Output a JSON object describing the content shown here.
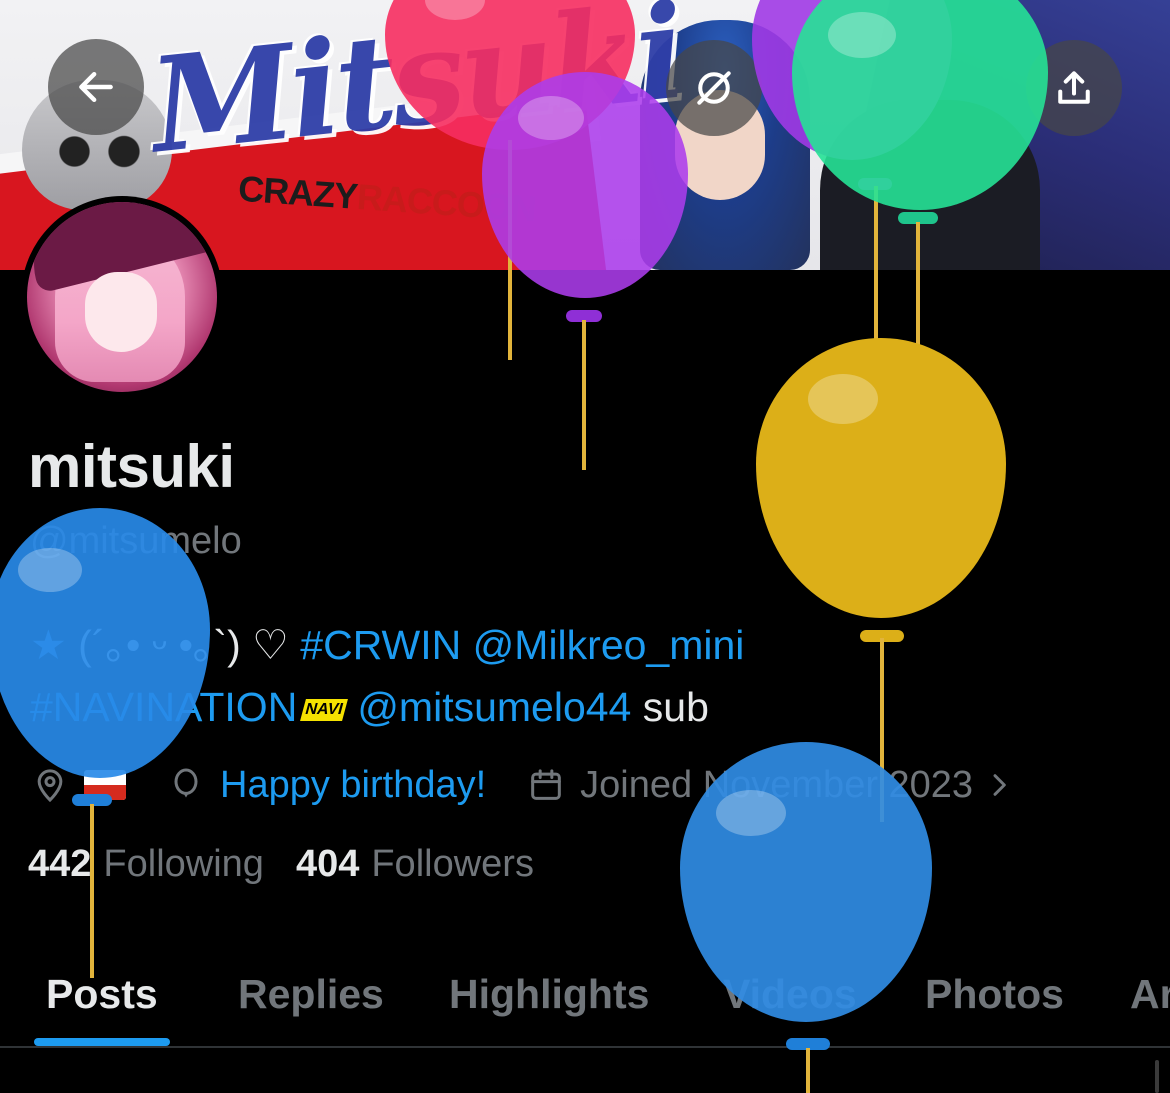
{
  "banner": {
    "logo_text": "Mitsuki",
    "crazy_text": "CRAZY",
    "raccoon_text": "RACCOON"
  },
  "top_bar": {
    "back_icon": "arrow-left-icon",
    "grok_icon": "grok-icon",
    "share_icon": "share-icon"
  },
  "profile": {
    "display_name": "mitsuki",
    "handle": "@mitsumelo",
    "bio": {
      "star": "★",
      "kaomoji": " (´｡• ᵕ •｡`) ♡ ",
      "tag_crwin": "#CRWIN",
      "mention_milkreo": "@Milkreo_mini",
      "tag_navi": "#NAVINATION",
      "navi_badge": "NAVI",
      "mention_sub": "@mitsumelo44",
      "sub_word": " sub"
    },
    "birthday_text": "Happy birthday!",
    "joined_text": "Joined November 2023",
    "following_count": "442",
    "following_label": "Following",
    "followers_count": "404",
    "followers_label": "Followers"
  },
  "tabs": [
    {
      "label": "Posts",
      "active": true
    },
    {
      "label": "Replies"
    },
    {
      "label": "Highlights"
    },
    {
      "label": "Videos"
    },
    {
      "label": "Photos"
    },
    {
      "label": "Articles"
    }
  ],
  "colors": {
    "link": "#1d9bf0",
    "muted": "#71767b",
    "text": "#e7e9ea",
    "background": "#000000"
  }
}
